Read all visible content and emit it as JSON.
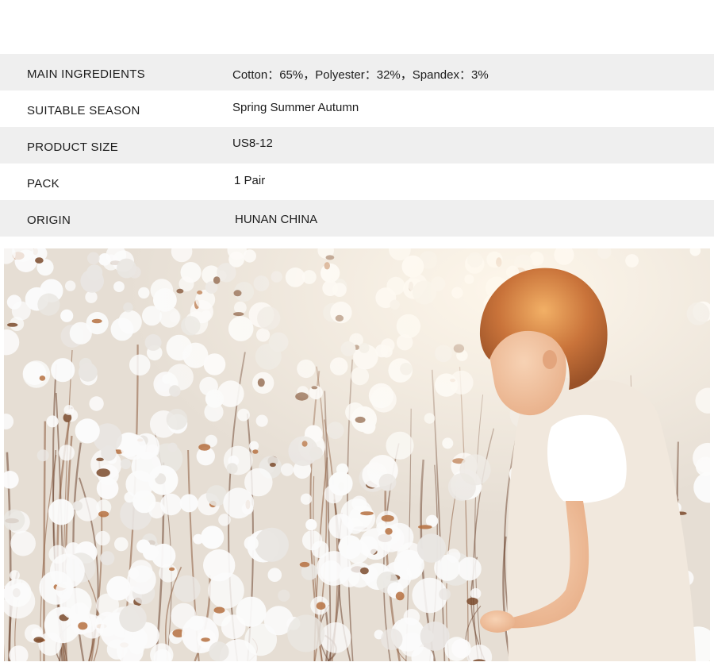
{
  "specs": [
    {
      "label": "MAIN INGREDIENTS",
      "value": "Cotton：65%，Polyester：32%，Spandex：3%"
    },
    {
      "label": "SUITABLE SEASON",
      "value": "Spring Summer Autumn"
    },
    {
      "label": "PRODUCT SIZE",
      "value": "US8-12"
    },
    {
      "label": "PACK",
      "value": "1 Pair"
    },
    {
      "label": "ORIGIN",
      "value": "HUNAN CHINA"
    }
  ],
  "colors": {
    "row_shaded": "#efefef",
    "row_plain": "#ffffff",
    "text": "#1c1c1c",
    "cotton_white": "#fbfbfb",
    "stem_brown": "#8a5a3a",
    "hair_auburn": "#c9733a",
    "vest_cream": "#f1e8dd"
  }
}
